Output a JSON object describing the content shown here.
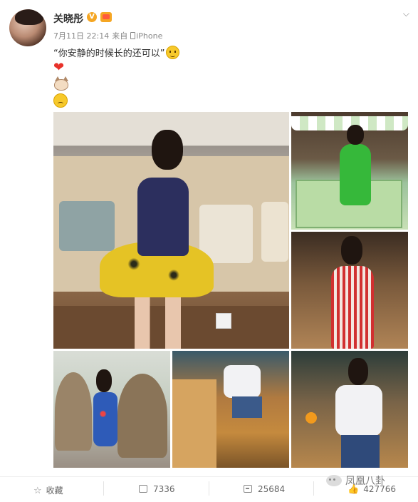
{
  "post": {
    "username": "关晓彤",
    "date": "7月11日 22:14",
    "source_prefix": "来自",
    "source_name": "iPhone",
    "text": "“你安静的时候长的还可以”",
    "emojis": [
      "heart-icon",
      "cat-face-icon",
      "angry-face-icon"
    ],
    "verified_label": "V"
  },
  "photos": [
    {
      "name": "photo-yellow-skirt"
    },
    {
      "name": "photo-green-dress"
    },
    {
      "name": "photo-striped-dress"
    },
    {
      "name": "photo-blue-dress"
    },
    {
      "name": "photo-cafe-shorts"
    },
    {
      "name": "photo-cafe-jeans"
    }
  ],
  "footer": {
    "favorite_label": "收藏",
    "repost_count": "7336",
    "comment_count": "25684",
    "like_count": "427766"
  },
  "watermark": {
    "text": "凤凰八卦"
  },
  "colors": {
    "background": "#ffffff",
    "username": "#333333",
    "meta": "#888888",
    "verified_badge": "#f5a623"
  }
}
